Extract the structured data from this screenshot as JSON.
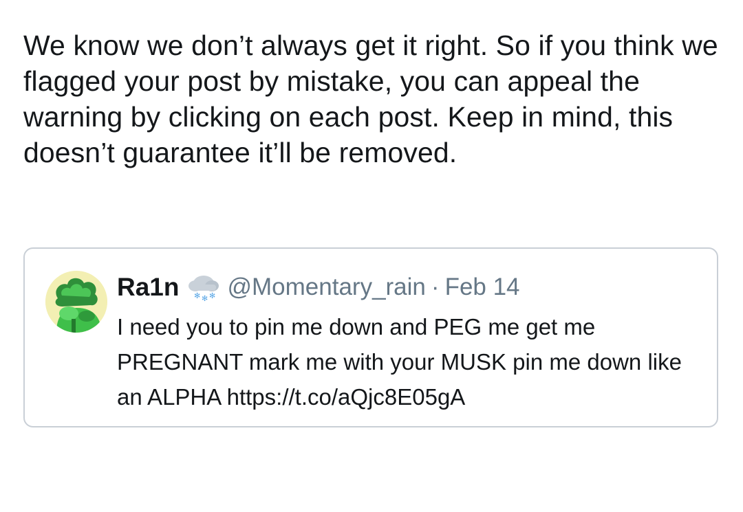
{
  "tweet": {
    "text": "We know we don’t always get it right. So if you think we flagged your post by mistake, you can appeal the warning by clicking on each post. Keep in mind, this doesn’t guarantee it’ll be removed."
  },
  "quoted_tweet": {
    "display_name": "Ra1n",
    "name_emoji_icon": "snow-cloud-icon",
    "handle": "@Momentary_rain",
    "separator": "·",
    "date": "Feb 14",
    "body": "I need you to pin me down and PEG me get me PREGNANT mark me with your MUSK pin me down like an ALPHA https://t.co/aQjc8E05gA",
    "avatar_icon": "green-character-avatar"
  },
  "colors": {
    "text": "#14171a",
    "secondary_text": "#657786",
    "card_border": "#c9cfd6",
    "avatar_bg": "#f3efb3",
    "avatar_green": "#3fbf4a"
  }
}
